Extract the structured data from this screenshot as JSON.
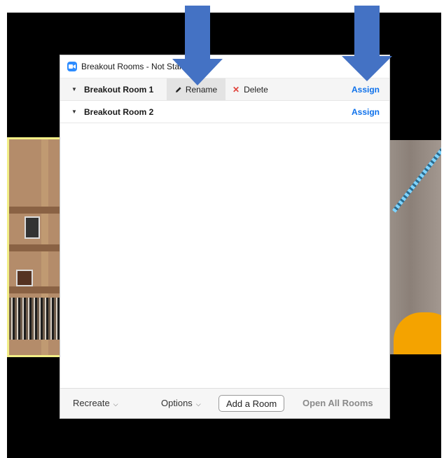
{
  "dialog": {
    "title": "Breakout Rooms - Not Started"
  },
  "rooms": [
    {
      "name": "Breakout Room 1",
      "rename_label": "Rename",
      "delete_label": "Delete",
      "assign_label": "Assign"
    },
    {
      "name": "Breakout Room 2",
      "assign_label": "Assign"
    }
  ],
  "footer": {
    "recreate_label": "Recreate",
    "options_label": "Options",
    "add_room_label": "Add a Room",
    "open_all_label": "Open All Rooms"
  },
  "colors": {
    "accent_blue": "#0e71eb",
    "annotation_arrow": "#4472c4",
    "delete_red": "#e0413a",
    "zoom_logo": "#2d8cff"
  },
  "icons": {
    "caret": "triangle-down",
    "rename": "pencil",
    "delete": "x-mark",
    "chevron": "chevron-down"
  }
}
